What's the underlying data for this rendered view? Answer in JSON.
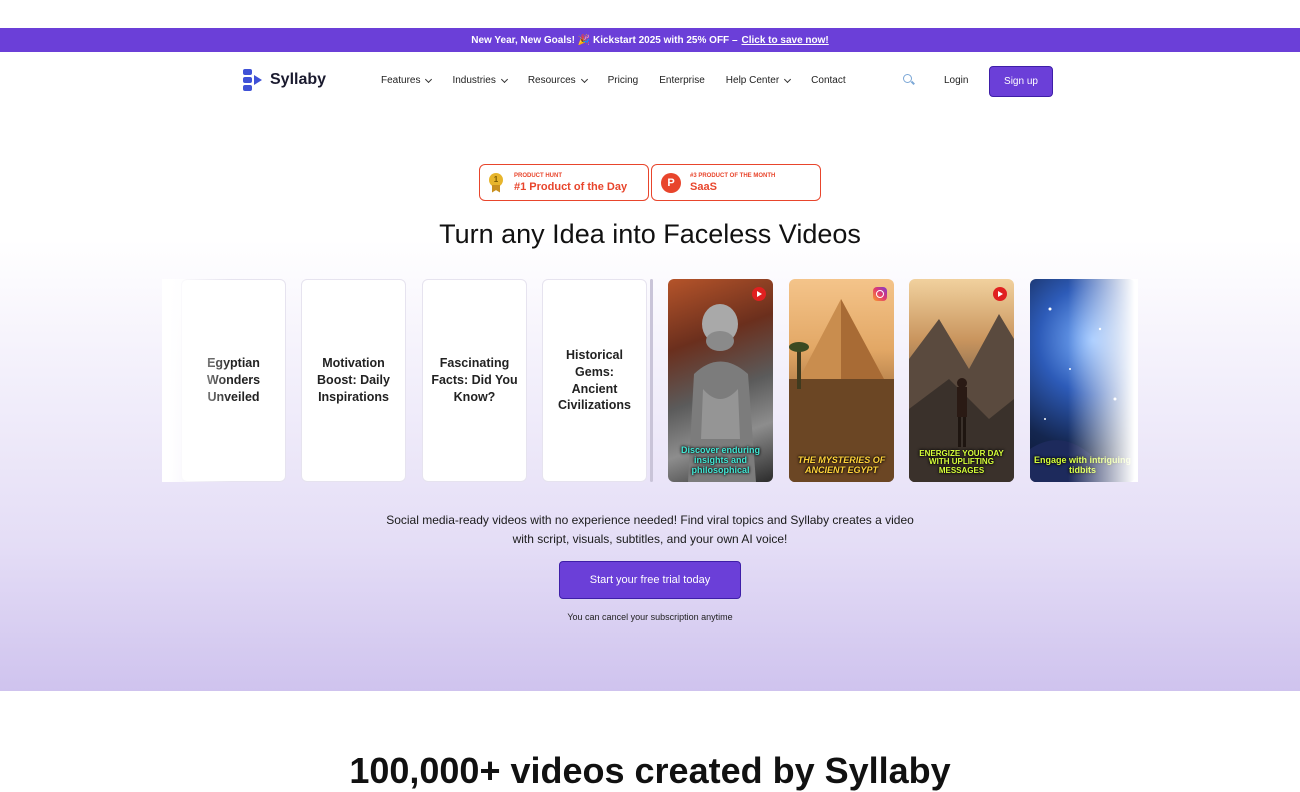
{
  "promo": {
    "text": "New Year, New Goals! 🎉 Kickstart 2025 with 25% OFF –",
    "link": "Click to save now!"
  },
  "nav": {
    "brand": "Syllaby",
    "items": [
      {
        "label": "Features",
        "dropdown": true
      },
      {
        "label": "Industries",
        "dropdown": true
      },
      {
        "label": "Resources",
        "dropdown": true
      },
      {
        "label": "Pricing",
        "dropdown": false
      },
      {
        "label": "Enterprise",
        "dropdown": false
      },
      {
        "label": "Help Center",
        "dropdown": true
      },
      {
        "label": "Contact",
        "dropdown": false
      }
    ],
    "login": "Login",
    "signup": "Sign up",
    "search_icon": "search-icon"
  },
  "badges": [
    {
      "kicker": "PRODUCT HUNT",
      "title": "#1 Product of the Day",
      "icon": "medal-icon",
      "medal_number": "1"
    },
    {
      "kicker": "#3 PRODUCT OF THE MONTH",
      "title": "SaaS",
      "icon": "product-hunt-icon",
      "letter": "P"
    }
  ],
  "hero": {
    "headline": "Turn any Idea into Faceless Videos",
    "subtitle_line1": "Social media-ready videos with no experience needed! Find viral topics and Syllaby creates a video",
    "subtitle_line2": "with script, visuals, subtitles, and your own AI voice!",
    "cta": "Start your free trial today",
    "cancel_note": "You can cancel your subscription anytime"
  },
  "topic_cards": [
    "Egyptian Wonders Unveiled",
    "Motivation Boost: Daily Inspirations",
    "Fascinating Facts: Did You Know?",
    "Historical Gems: Ancient Civilizations"
  ],
  "video_cards": [
    {
      "caption": "Discover enduring insights and philosophical",
      "platform": "youtube",
      "caption_color": "#41e6d4"
    },
    {
      "caption": "THE MYSTERIES OF ANCIENT EGYPT",
      "platform": "instagram",
      "caption_color": "#ffd23a"
    },
    {
      "caption": "ENERGIZE YOUR DAY WITH UPLIFTING MESSAGES",
      "platform": "youtube",
      "caption_color": "#d6ff3a"
    },
    {
      "caption": "Engage with intriguing tidbits",
      "platform": "none",
      "caption_color": "#d6ff3a"
    }
  ],
  "bottom": {
    "title": "100,000+ videos created by Syllaby"
  },
  "colors": {
    "brand_purple": "#6b3fd8",
    "product_hunt_red": "#e8452c",
    "logo_blue": "#3f51d6"
  }
}
